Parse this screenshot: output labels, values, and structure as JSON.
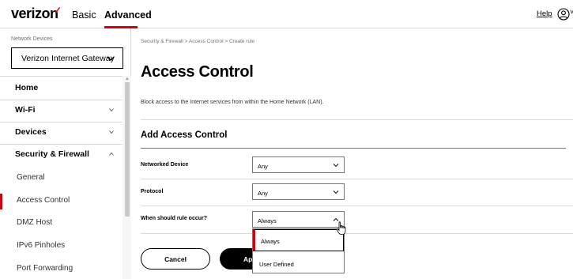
{
  "header": {
    "brand": "verizon",
    "brand_mark": "✓",
    "tabs": [
      "Basic",
      "Advanced"
    ],
    "active_tab": "Advanced",
    "help_label": "Help",
    "user_caret": "˅",
    "accent_color": "#cd040b"
  },
  "sidebar": {
    "device_label": "Network Devices",
    "device_value": "Verizon Internet Gateway",
    "items": [
      {
        "label": "Home"
      },
      {
        "label": "Wi-Fi"
      },
      {
        "label": "Devices"
      },
      {
        "label": "Security & Firewall"
      },
      {
        "label": "General"
      },
      {
        "label": "Access Control"
      },
      {
        "label": "DMZ Host"
      },
      {
        "label": "IPv6 Pinholes"
      },
      {
        "label": "Port Forwarding"
      }
    ],
    "active_item": "Access Control"
  },
  "main": {
    "breadcrumb": "Security & Firewall  >  Access Control  >  Create rule",
    "title": "Access Control",
    "description": "Block access to the Internet services from within the Home Network (LAN).",
    "section_title": "Add Access Control",
    "fields": [
      {
        "label": "Networked Device",
        "value": "Any"
      },
      {
        "label": "Protocol",
        "value": "Any"
      },
      {
        "label": "When should rule occur?",
        "value": "Always"
      }
    ],
    "rule_options": [
      "Always",
      "User Defined"
    ],
    "cancel_label": "Cancel",
    "apply_label": "Ap"
  }
}
